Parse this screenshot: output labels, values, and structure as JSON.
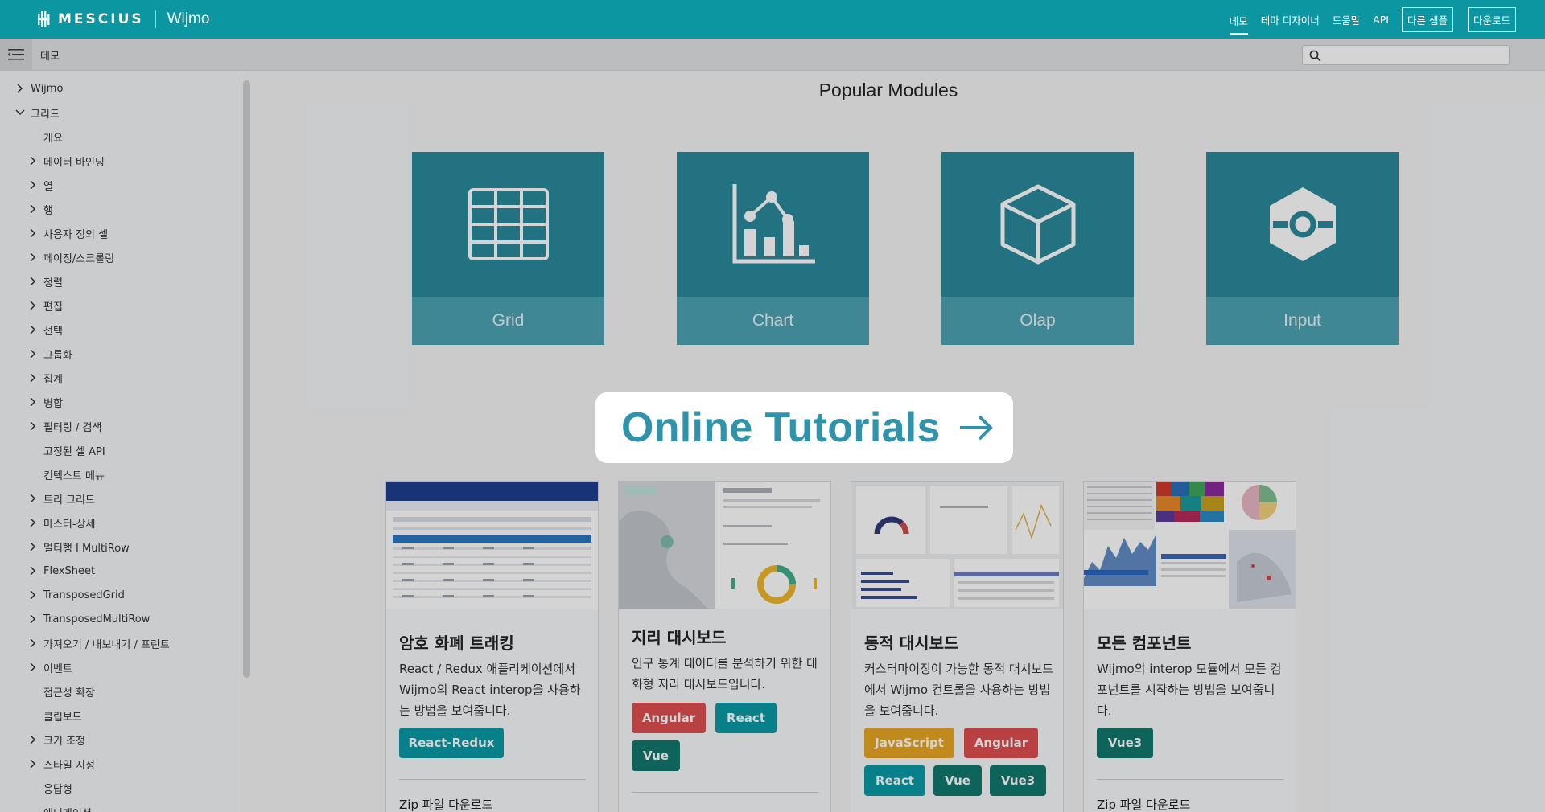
{
  "header": {
    "brand": "MESCIUS",
    "product": "Wijmo",
    "nav": [
      {
        "label": "데모",
        "active": true
      },
      {
        "label": "테마 디자이너"
      },
      {
        "label": "도움말"
      },
      {
        "label": "API"
      }
    ],
    "buttons": [
      "다른 샘플",
      "다운로드"
    ]
  },
  "subbar": {
    "title": "데모",
    "search_placeholder": ""
  },
  "sidebar": {
    "items": [
      {
        "label": "Wijmo",
        "level": 0,
        "state": "collapsed"
      },
      {
        "label": "그리드",
        "level": 0,
        "state": "expanded"
      },
      {
        "label": "개요",
        "level": 1,
        "state": "leaf"
      },
      {
        "label": "데이터 바인딩",
        "level": 1,
        "state": "collapsed"
      },
      {
        "label": "열",
        "level": 1,
        "state": "collapsed"
      },
      {
        "label": "행",
        "level": 1,
        "state": "collapsed"
      },
      {
        "label": "사용자 정의 셀",
        "level": 1,
        "state": "collapsed"
      },
      {
        "label": "페이징/스크롤링",
        "level": 1,
        "state": "collapsed"
      },
      {
        "label": "정렬",
        "level": 1,
        "state": "collapsed"
      },
      {
        "label": "편집",
        "level": 1,
        "state": "collapsed"
      },
      {
        "label": "선택",
        "level": 1,
        "state": "collapsed"
      },
      {
        "label": "그룹화",
        "level": 1,
        "state": "collapsed"
      },
      {
        "label": "집계",
        "level": 1,
        "state": "collapsed"
      },
      {
        "label": "병합",
        "level": 1,
        "state": "collapsed"
      },
      {
        "label": "필터링 / 검색",
        "level": 1,
        "state": "collapsed"
      },
      {
        "label": "고정된 셀 API",
        "level": 1,
        "state": "leaf"
      },
      {
        "label": "컨텍스트 메뉴",
        "level": 1,
        "state": "leaf"
      },
      {
        "label": "트리 그리드",
        "level": 1,
        "state": "collapsed"
      },
      {
        "label": "마스터-상세",
        "level": 1,
        "state": "collapsed"
      },
      {
        "label": "멀티행 I MultiRow",
        "level": 1,
        "state": "collapsed"
      },
      {
        "label": "FlexSheet",
        "level": 1,
        "state": "collapsed"
      },
      {
        "label": "TransposedGrid",
        "level": 1,
        "state": "collapsed"
      },
      {
        "label": "TransposedMultiRow",
        "level": 1,
        "state": "collapsed"
      },
      {
        "label": "가져오기 / 내보내기 / 프린트",
        "level": 1,
        "state": "collapsed"
      },
      {
        "label": "이벤트",
        "level": 1,
        "state": "collapsed"
      },
      {
        "label": "접근성 확장",
        "level": 1,
        "state": "leaf"
      },
      {
        "label": "클립보드",
        "level": 1,
        "state": "leaf"
      },
      {
        "label": "크기 조정",
        "level": 1,
        "state": "collapsed"
      },
      {
        "label": "스타일 지정",
        "level": 1,
        "state": "collapsed"
      },
      {
        "label": "응답형",
        "level": 1,
        "state": "leaf"
      },
      {
        "label": "애니메이션",
        "level": 1,
        "state": "leaf"
      }
    ]
  },
  "main": {
    "section_title": "Popular Modules",
    "modules": [
      {
        "label": "Grid",
        "icon": "grid-icon"
      },
      {
        "label": "Chart",
        "icon": "chart-icon"
      },
      {
        "label": "Olap",
        "icon": "cube-icon"
      },
      {
        "label": "Input",
        "icon": "input-icon"
      }
    ],
    "cta": {
      "label": "Online Tutorials",
      "arrow": "→"
    },
    "cards": [
      {
        "title": "암호 화폐 트래킹",
        "description": "React / Redux 애플리케이션에서 Wijmo의 React interop을 사용하는 방법을 보여줍니다.",
        "tags": [
          {
            "label": "React-Redux",
            "color": "teal"
          }
        ],
        "zip": "Zip 파일 다운로드"
      },
      {
        "title": "지리 대시보드",
        "description": "인구 통계 데이터를 분석하기 위한 대화형 지리 대시보드입니다.",
        "tags": [
          {
            "label": "Angular",
            "color": "red"
          },
          {
            "label": "React",
            "color": "teal"
          },
          {
            "label": "Vue",
            "color": "green"
          }
        ],
        "zip": ""
      },
      {
        "title": "동적 대시보드",
        "description": "커스터마이징이 가능한 동적 대시보드에서 Wijmo 컨트롤을 사용하는 방법을 보여줍니다.",
        "tags": [
          {
            "label": "JavaScript",
            "color": "orange"
          },
          {
            "label": "Angular",
            "color": "red"
          },
          {
            "label": "React",
            "color": "teal"
          },
          {
            "label": "Vue",
            "color": "green"
          },
          {
            "label": "Vue3",
            "color": "green"
          }
        ],
        "zip": ""
      },
      {
        "title": "모든 컴포넌트",
        "description": "Wijmo의 interop 모듈에서 모든 컴포넌트를 시작하는 방법을 보여줍니다.",
        "tags": [
          {
            "label": "Vue3",
            "color": "green"
          }
        ],
        "zip": "Zip 파일 다운로드"
      }
    ]
  },
  "colors": {
    "header": "#0b96a2",
    "module_bg": "#2b8a9d",
    "module_label_bg": "#4ea3b4",
    "cta_text": "#2f93ac",
    "tag_teal": "#0a9aa6",
    "tag_red": "#df4f4f",
    "tag_green": "#12796d",
    "tag_orange": "#e9a624"
  }
}
